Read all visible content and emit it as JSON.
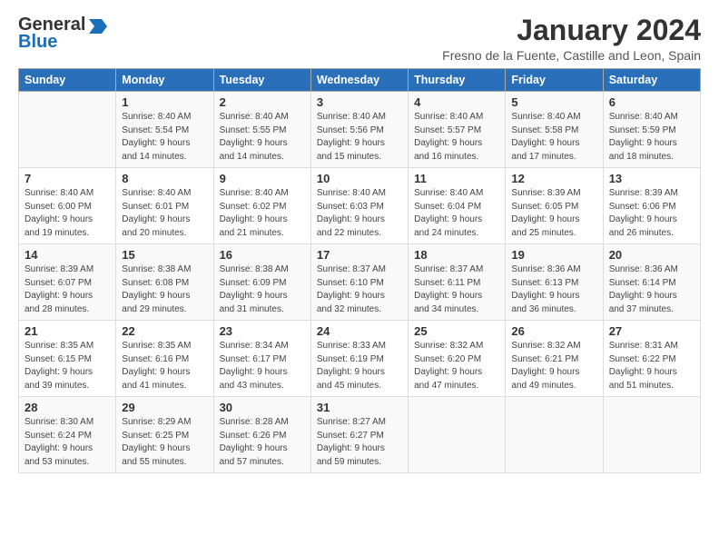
{
  "logo": {
    "line1": "General",
    "line2": "Blue"
  },
  "title": "January 2024",
  "location": "Fresno de la Fuente, Castille and Leon, Spain",
  "days_header": [
    "Sunday",
    "Monday",
    "Tuesday",
    "Wednesday",
    "Thursday",
    "Friday",
    "Saturday"
  ],
  "weeks": [
    [
      {
        "day": "",
        "info": ""
      },
      {
        "day": "1",
        "info": "Sunrise: 8:40 AM\nSunset: 5:54 PM\nDaylight: 9 hours\nand 14 minutes."
      },
      {
        "day": "2",
        "info": "Sunrise: 8:40 AM\nSunset: 5:55 PM\nDaylight: 9 hours\nand 14 minutes."
      },
      {
        "day": "3",
        "info": "Sunrise: 8:40 AM\nSunset: 5:56 PM\nDaylight: 9 hours\nand 15 minutes."
      },
      {
        "day": "4",
        "info": "Sunrise: 8:40 AM\nSunset: 5:57 PM\nDaylight: 9 hours\nand 16 minutes."
      },
      {
        "day": "5",
        "info": "Sunrise: 8:40 AM\nSunset: 5:58 PM\nDaylight: 9 hours\nand 17 minutes."
      },
      {
        "day": "6",
        "info": "Sunrise: 8:40 AM\nSunset: 5:59 PM\nDaylight: 9 hours\nand 18 minutes."
      }
    ],
    [
      {
        "day": "7",
        "info": "Sunrise: 8:40 AM\nSunset: 6:00 PM\nDaylight: 9 hours\nand 19 minutes."
      },
      {
        "day": "8",
        "info": "Sunrise: 8:40 AM\nSunset: 6:01 PM\nDaylight: 9 hours\nand 20 minutes."
      },
      {
        "day": "9",
        "info": "Sunrise: 8:40 AM\nSunset: 6:02 PM\nDaylight: 9 hours\nand 21 minutes."
      },
      {
        "day": "10",
        "info": "Sunrise: 8:40 AM\nSunset: 6:03 PM\nDaylight: 9 hours\nand 22 minutes."
      },
      {
        "day": "11",
        "info": "Sunrise: 8:40 AM\nSunset: 6:04 PM\nDaylight: 9 hours\nand 24 minutes."
      },
      {
        "day": "12",
        "info": "Sunrise: 8:39 AM\nSunset: 6:05 PM\nDaylight: 9 hours\nand 25 minutes."
      },
      {
        "day": "13",
        "info": "Sunrise: 8:39 AM\nSunset: 6:06 PM\nDaylight: 9 hours\nand 26 minutes."
      }
    ],
    [
      {
        "day": "14",
        "info": "Sunrise: 8:39 AM\nSunset: 6:07 PM\nDaylight: 9 hours\nand 28 minutes."
      },
      {
        "day": "15",
        "info": "Sunrise: 8:38 AM\nSunset: 6:08 PM\nDaylight: 9 hours\nand 29 minutes."
      },
      {
        "day": "16",
        "info": "Sunrise: 8:38 AM\nSunset: 6:09 PM\nDaylight: 9 hours\nand 31 minutes."
      },
      {
        "day": "17",
        "info": "Sunrise: 8:37 AM\nSunset: 6:10 PM\nDaylight: 9 hours\nand 32 minutes."
      },
      {
        "day": "18",
        "info": "Sunrise: 8:37 AM\nSunset: 6:11 PM\nDaylight: 9 hours\nand 34 minutes."
      },
      {
        "day": "19",
        "info": "Sunrise: 8:36 AM\nSunset: 6:13 PM\nDaylight: 9 hours\nand 36 minutes."
      },
      {
        "day": "20",
        "info": "Sunrise: 8:36 AM\nSunset: 6:14 PM\nDaylight: 9 hours\nand 37 minutes."
      }
    ],
    [
      {
        "day": "21",
        "info": "Sunrise: 8:35 AM\nSunset: 6:15 PM\nDaylight: 9 hours\nand 39 minutes."
      },
      {
        "day": "22",
        "info": "Sunrise: 8:35 AM\nSunset: 6:16 PM\nDaylight: 9 hours\nand 41 minutes."
      },
      {
        "day": "23",
        "info": "Sunrise: 8:34 AM\nSunset: 6:17 PM\nDaylight: 9 hours\nand 43 minutes."
      },
      {
        "day": "24",
        "info": "Sunrise: 8:33 AM\nSunset: 6:19 PM\nDaylight: 9 hours\nand 45 minutes."
      },
      {
        "day": "25",
        "info": "Sunrise: 8:32 AM\nSunset: 6:20 PM\nDaylight: 9 hours\nand 47 minutes."
      },
      {
        "day": "26",
        "info": "Sunrise: 8:32 AM\nSunset: 6:21 PM\nDaylight: 9 hours\nand 49 minutes."
      },
      {
        "day": "27",
        "info": "Sunrise: 8:31 AM\nSunset: 6:22 PM\nDaylight: 9 hours\nand 51 minutes."
      }
    ],
    [
      {
        "day": "28",
        "info": "Sunrise: 8:30 AM\nSunset: 6:24 PM\nDaylight: 9 hours\nand 53 minutes."
      },
      {
        "day": "29",
        "info": "Sunrise: 8:29 AM\nSunset: 6:25 PM\nDaylight: 9 hours\nand 55 minutes."
      },
      {
        "day": "30",
        "info": "Sunrise: 8:28 AM\nSunset: 6:26 PM\nDaylight: 9 hours\nand 57 minutes."
      },
      {
        "day": "31",
        "info": "Sunrise: 8:27 AM\nSunset: 6:27 PM\nDaylight: 9 hours\nand 59 minutes."
      },
      {
        "day": "",
        "info": ""
      },
      {
        "day": "",
        "info": ""
      },
      {
        "day": "",
        "info": ""
      }
    ]
  ]
}
